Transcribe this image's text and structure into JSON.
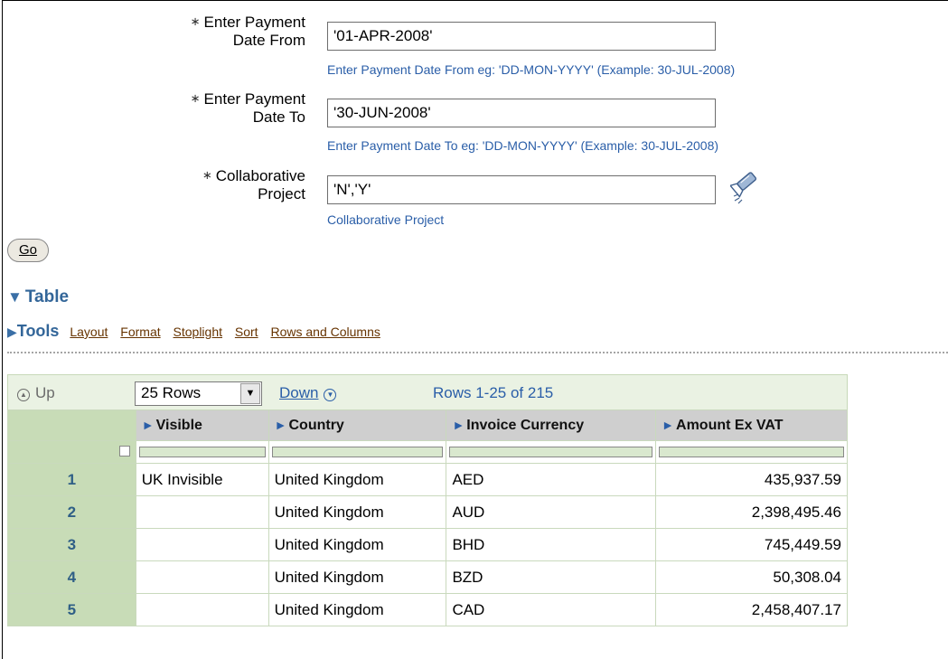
{
  "form": {
    "required_marker": "∗",
    "payment_from": {
      "label_line1": "Enter Payment",
      "label_line2": "Date From",
      "value": "'01-APR-2008'",
      "hint": "Enter Payment Date From eg: 'DD-MON-YYYY' (Example: 30-JUL-2008)"
    },
    "payment_to": {
      "label_line1": "Enter Payment",
      "label_line2": "Date To",
      "value": "'30-JUN-2008'",
      "hint": "Enter Payment Date To eg: 'DD-MON-YYYY' (Example: 30-JUL-2008)"
    },
    "collaborative": {
      "label_line1": "Collaborative",
      "label_line2": "Project",
      "value": "'N','Y'",
      "hint": "Collaborative Project",
      "search_icon": "flashlight-icon"
    },
    "go_label_prefix": "G",
    "go_label_underlined": "o"
  },
  "table_section": {
    "title": "Table",
    "tools_label": "Tools",
    "tools_links": [
      "Layout",
      "Format",
      "Stoplight",
      "Sort",
      "Rows and Columns"
    ]
  },
  "nav": {
    "up_label": "Up",
    "rows_per_page": "25 Rows",
    "down_label": "Down",
    "range_label": "Rows 1-25 of 215"
  },
  "grid": {
    "columns": [
      "Visible",
      "Country",
      "Invoice Currency",
      "Amount Ex VAT"
    ],
    "rows": [
      {
        "num": "1",
        "visible": "UK Invisible",
        "country": "United Kingdom",
        "currency": "AED",
        "amount": "435,937.59"
      },
      {
        "num": "2",
        "visible": "",
        "country": "United Kingdom",
        "currency": "AUD",
        "amount": "2,398,495.46"
      },
      {
        "num": "3",
        "visible": "",
        "country": "United Kingdom",
        "currency": "BHD",
        "amount": "745,449.59"
      },
      {
        "num": "4",
        "visible": "",
        "country": "United Kingdom",
        "currency": "BZD",
        "amount": "50,308.04"
      },
      {
        "num": "5",
        "visible": "",
        "country": "United Kingdom",
        "currency": "CAD",
        "amount": "2,458,407.17"
      }
    ]
  },
  "colors": {
    "link_blue": "#2a5ea8",
    "header_blue": "#336699",
    "tools_link_brown": "#663300",
    "row_header_green": "#c8dcb7",
    "nav_bar_green": "#eaf2e3"
  }
}
